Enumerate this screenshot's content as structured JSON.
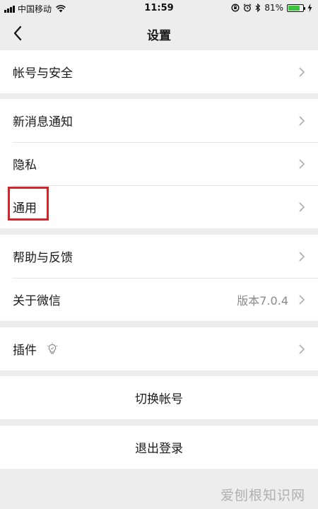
{
  "status_bar": {
    "carrier": "中国移动",
    "time": "11:59",
    "battery_percent": "81%",
    "battery_level": 0.81,
    "battery_color": "#3cc43c"
  },
  "nav": {
    "title": "设置",
    "back_icon": "chevron-left-icon"
  },
  "groups": {
    "account": {
      "label": "帐号与安全"
    },
    "notify": {
      "label": "新消息通知"
    },
    "privacy": {
      "label": "隐私"
    },
    "general": {
      "label": "通用"
    },
    "help": {
      "label": "帮助与反馈"
    },
    "about": {
      "label": "关于微信",
      "value": "版本7.0.4"
    },
    "plugins": {
      "label": "插件",
      "icon": "lightbulb-icon"
    }
  },
  "actions": {
    "switch_account": "切换帐号",
    "logout": "退出登录"
  },
  "watermark": "爱刨根知识网",
  "colors": {
    "background": "#ededed",
    "card": "#ffffff",
    "highlight": "#d6242a",
    "secondary_text": "#8a8a8a"
  }
}
